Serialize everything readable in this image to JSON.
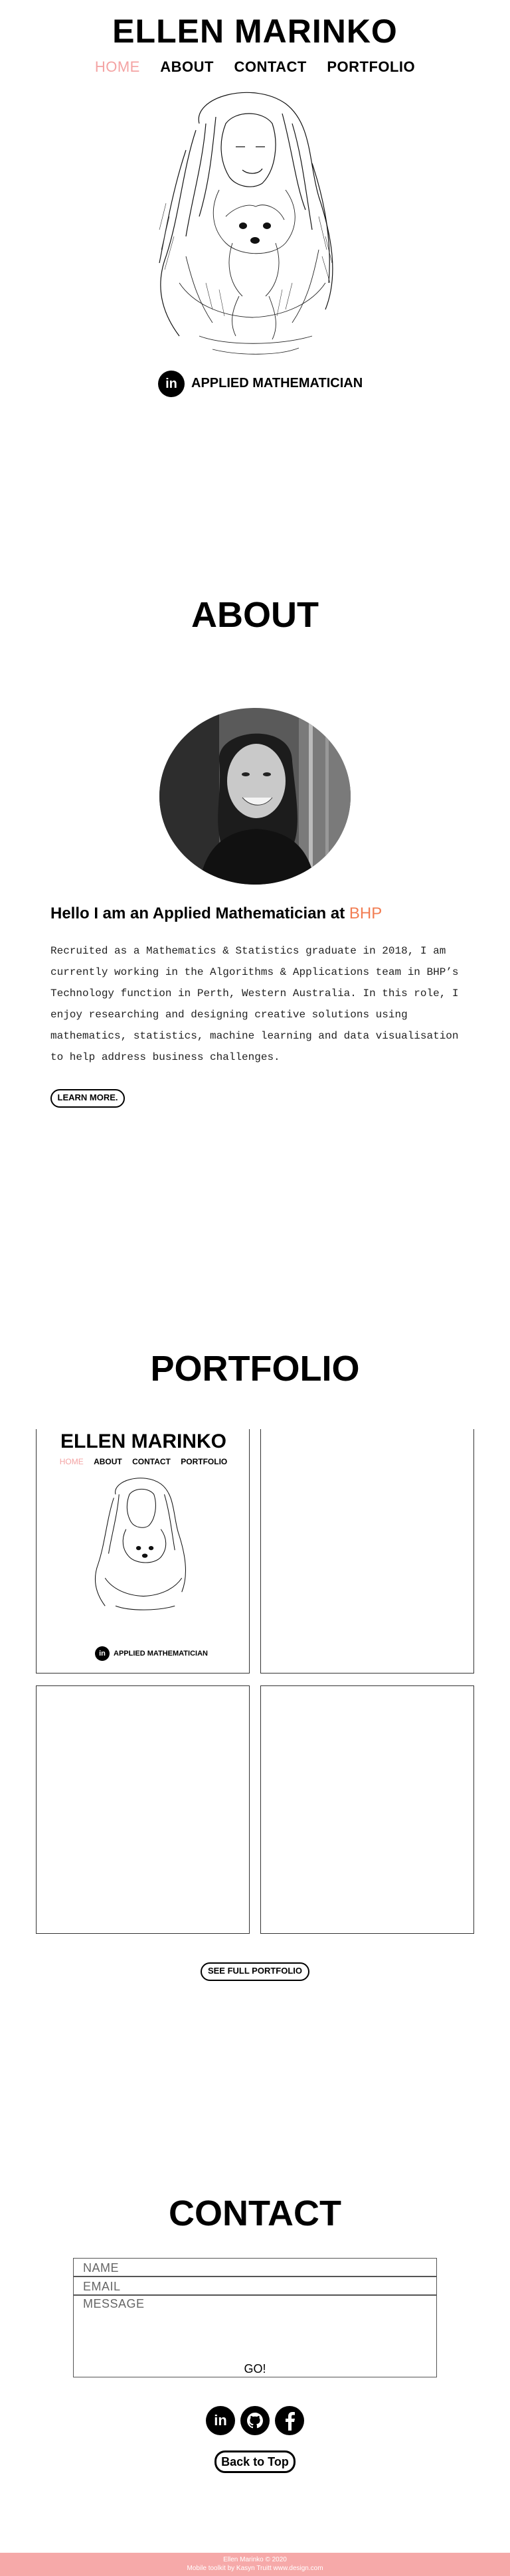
{
  "header": {
    "site_title": "ELLEN MARINKO",
    "nav": [
      "HOME",
      "ABOUT",
      "CONTACT",
      "PORTFOLIO"
    ],
    "tagline": "APPLIED MATHEMATICIAN",
    "linkedin_glyph": "in"
  },
  "about": {
    "heading": "ABOUT",
    "hello_prefix": "Hello I am an Applied Mathematician at ",
    "hello_company": "BHP",
    "paragraph": "Recruited as a Mathematics & Statistics graduate in 2018, I am currently working in the Algorithms & Applications team in BHP’s Technology function in Perth, Western Australia. In this role, I enjoy researching and designing creative solutions using mathematics, statistics, machine learning and data visualisation to help address business challenges.",
    "learn_more": "LEARN MORE."
  },
  "portfolio": {
    "heading": "PORTFOLIO",
    "preview": {
      "title": "ELLEN MARINKO",
      "nav": [
        "HOME",
        "ABOUT",
        "CONTACT",
        "PORTFOLIO"
      ],
      "tagline": "APPLIED MATHEMATICIAN",
      "linkedin_glyph": "in"
    },
    "see_full": "SEE FULL PORTFOLIO"
  },
  "contact": {
    "heading": "CONTACT",
    "name_placeholder": "NAME",
    "email_placeholder": "EMAIL",
    "message_placeholder": "MESSAGE",
    "submit": "GO!",
    "linkedin_glyph": "in",
    "back_to_top": "Back to Top"
  },
  "footer": {
    "line1": "Ellen Marinko © 2020",
    "line2": "Mobile toolkit by Kasyn Truitt www.design.com"
  },
  "colors": {
    "accent_pink": "#f4a3a3",
    "bhp_orange": "#f27d52",
    "footer_bg": "#f6a9a9"
  },
  "icons": [
    "linkedin-icon",
    "github-icon",
    "facebook-icon"
  ]
}
